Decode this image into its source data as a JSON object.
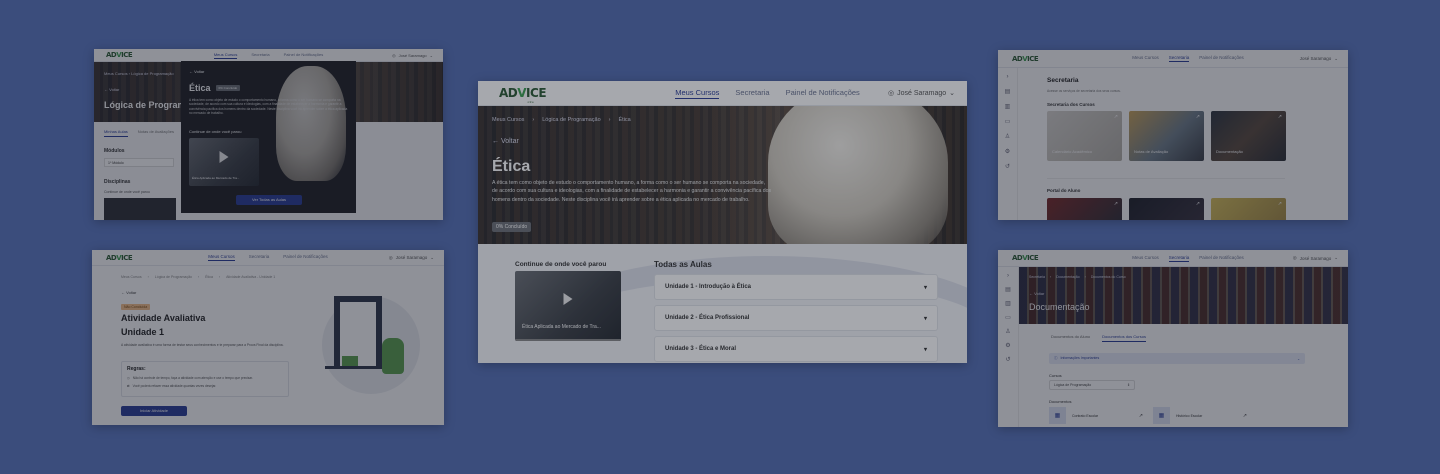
{
  "brand": {
    "logo": "ADVICE"
  },
  "nav": {
    "items": [
      "Meus Cursos",
      "Secretaria",
      "Painel de Notificações"
    ],
    "user": "José Saramago"
  },
  "main": {
    "breadcrumb": [
      "Meus Cursos",
      "Lógica de Programação",
      "Ética"
    ],
    "back": "Voltar",
    "title": "Ética",
    "description": "A ética tem como objeto de estudo o comportamento humano, a forma como o ser humano se comporta na sociedade, de acordo com sua cultura e ideologias, com a finalidade de estabelecer a harmonia e garantir a convivência pacífica dos homens dentro da sociedade. Neste disciplina você irá aprender sobre a ética aplicada no mercado de trabalho.",
    "progress_badge": "0% Concluído",
    "continue_title": "Continue de onde você parou",
    "continue_video": "Ética Aplicada ao Mercado de Tra...",
    "all_lessons_title": "Todas as Aulas",
    "lessons": [
      "Unidade 1 - Introdução à Ética",
      "Unidade 2 - Ética Profissional",
      "Unidade 3 - Ética e Moral"
    ]
  },
  "top_left": {
    "breadcrumb": [
      "Meus Cursos",
      "Lógica de Programação"
    ],
    "back": "Voltar",
    "title": "Lógica de Programação",
    "tabs": [
      "Minhas Aulas",
      "Notas de Avaliações"
    ],
    "modules_label": "Módulos",
    "module_select": "1º Módulo",
    "disciplines_label": "Disciplinas",
    "continue_label": "Continue de onde você parou",
    "modal": {
      "back": "Voltar",
      "title": "Ética",
      "badge": "0% Concluído",
      "text": "A ética tem como objeto de estudo o comportamento humano, a forma como o ser humano se comporta na sociedade, de acordo com sua cultura e ideologias, com a finalidade de estabelecer a harmonia e garantir a convivência pacífica dos homens dentro da sociedade. Neste disciplina você irá aprender sobre a ética aplicada no mercado de trabalho.",
      "continue_label": "Continue de onde você parou",
      "video": "Ética Aplicada ao Mercado de Tra...",
      "button": "Ver Todas as Aulas"
    }
  },
  "bottom_left": {
    "breadcrumb": [
      "Meus Cursos",
      "Lógica de Programação",
      "Ética",
      "Atividade Avaliativa - Unidade 1"
    ],
    "back": "Voltar",
    "status": "Não Concluída",
    "title_line1": "Atividade Avaliativa",
    "title_line2": "Unidade 1",
    "description": "A atividade avaliativa é uma forma de testar seus conhecimentos e te preparar para a Prova Final da disciplina.",
    "rules_title": "Regras:",
    "rules": [
      "Não há controle de tempo, faça a atividade com atenção e use o tempo que precisar.",
      "Você poderá refazer essa atividade quantas vezes desejar."
    ],
    "button": "Iniciar Atividade"
  },
  "top_right": {
    "title": "Secretaria",
    "subtitle": "Acesse os serviços de secretaria dos seus cursos.",
    "section1": "Secretaria dos Cursos",
    "tiles": [
      "Calendário Acadêmico",
      "Notas de Avaliação",
      "Documentação"
    ],
    "section2": "Portal do Aluno"
  },
  "bottom_right": {
    "breadcrumb": [
      "Secretaria",
      "Documentação",
      "Documentos do Curso"
    ],
    "back": "Voltar",
    "title": "Documentação",
    "tabs": [
      "Documentos do Aluno",
      "Documentos dos Cursos"
    ],
    "info": "Informações Importantes",
    "course_label": "Cursos",
    "course_select": "Lógica de Programação",
    "docs_label": "Documentos",
    "docs": [
      "Contrato Escolar",
      "Histórico Escolar"
    ]
  },
  "colors": {
    "background": "#3b4d7c",
    "accent": "#2a3d98",
    "logo_green": "#3aa050"
  }
}
